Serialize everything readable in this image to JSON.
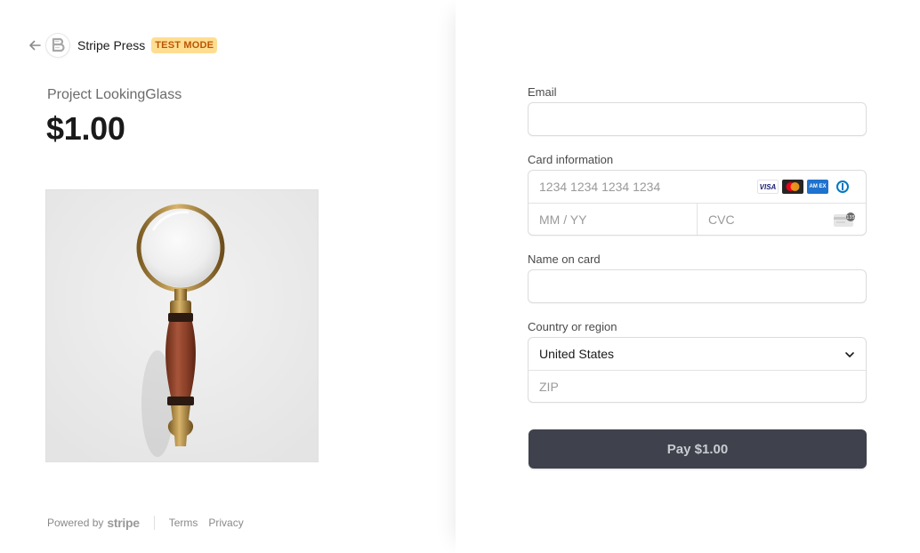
{
  "header": {
    "merchant_name": "Stripe Press",
    "mode_badge": "TEST MODE",
    "back_icon": "arrow-left-icon",
    "logo_icon": "stripe-press-logo"
  },
  "product": {
    "name": "Project LookingGlass",
    "price": "$1.00",
    "image_icon": "magnifying-glass-image"
  },
  "footer": {
    "powered_by": "Powered by",
    "stripe_brand": "stripe",
    "terms": "Terms",
    "privacy": "Privacy"
  },
  "form": {
    "email": {
      "label": "Email",
      "value": "",
      "placeholder": ""
    },
    "card": {
      "label": "Card information",
      "number_placeholder": "1234 1234 1234 1234",
      "expiry_placeholder": "MM / YY",
      "cvc_placeholder": "CVC",
      "brands": [
        "visa",
        "mastercard",
        "amex",
        "diners"
      ],
      "brand_labels": {
        "visa": "VISA",
        "amex": "AM EX"
      }
    },
    "name": {
      "label": "Name on card",
      "value": ""
    },
    "country": {
      "label": "Country or region",
      "selected": "United States",
      "zip_placeholder": "ZIP"
    }
  },
  "pay_button": {
    "label": "Pay $1.00"
  },
  "colors": {
    "badge_bg": "#ffde92",
    "badge_text": "#bb5504",
    "pay_button_bg": "#3f424c",
    "pay_button_text": "#c9cbd1"
  }
}
